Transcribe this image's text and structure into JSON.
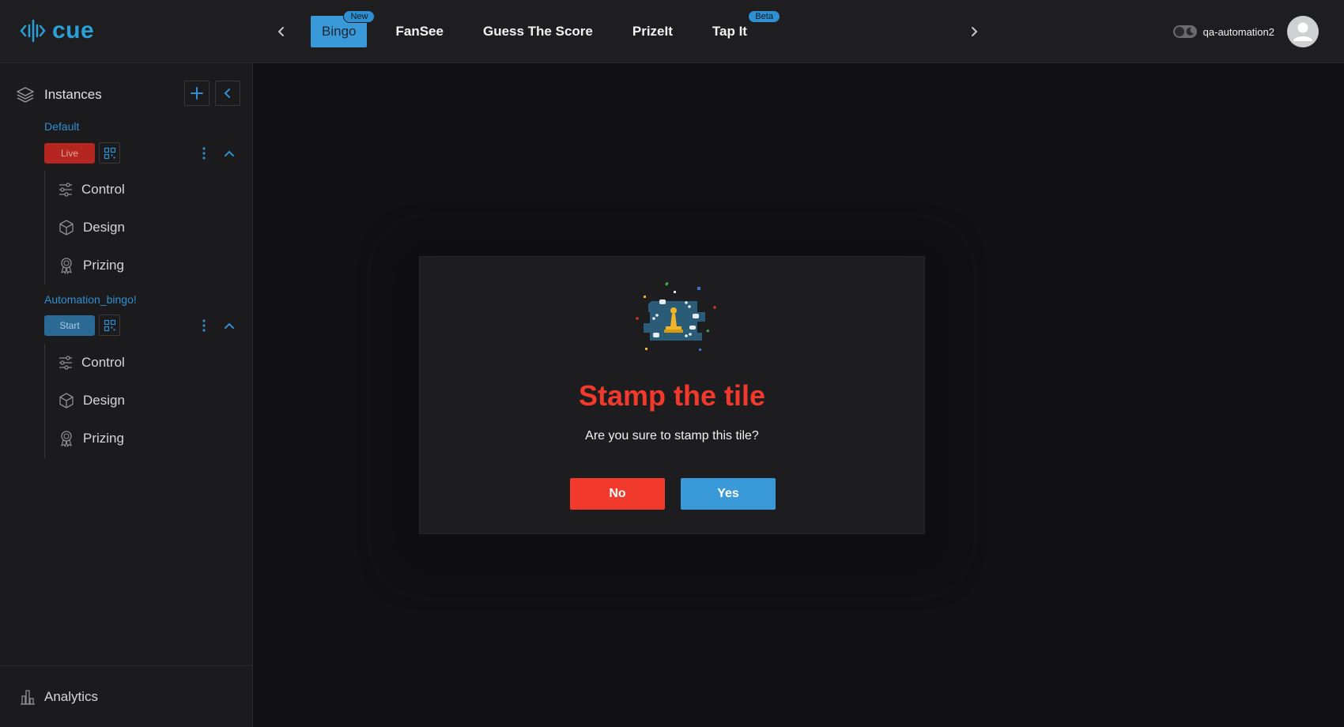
{
  "brand": {
    "name": "cue",
    "accent": "#2a9fd8"
  },
  "nav": {
    "tabs": [
      {
        "label": "Bingo",
        "badge": "New",
        "active": true
      },
      {
        "label": "FanSee",
        "badge": "",
        "active": false
      },
      {
        "label": "Guess The Score",
        "badge": "",
        "active": false
      },
      {
        "label": "PrizeIt",
        "badge": "",
        "active": false
      },
      {
        "label": "Tap It",
        "badge": "Beta",
        "active": false
      }
    ]
  },
  "user": {
    "name": "qa-automation2"
  },
  "sidebar": {
    "title": "Instances",
    "instances": [
      {
        "name": "Default",
        "status": "Live",
        "items": [
          {
            "label": "Control",
            "icon": "sliders-icon"
          },
          {
            "label": "Design",
            "icon": "cube-icon"
          },
          {
            "label": "Prizing",
            "icon": "award-icon"
          }
        ]
      },
      {
        "name": "Automation_bingo!",
        "status": "Start",
        "items": [
          {
            "label": "Control",
            "icon": "sliders-icon"
          },
          {
            "label": "Design",
            "icon": "cube-icon"
          },
          {
            "label": "Prizing",
            "icon": "award-icon"
          }
        ]
      }
    ],
    "footer": {
      "label": "Analytics"
    }
  },
  "modal": {
    "title": "Stamp the tile",
    "message": "Are you sure to stamp this tile?",
    "no_label": "No",
    "yes_label": "Yes",
    "title_color": "#f23a2c",
    "yes_color": "#3a9ad9"
  }
}
